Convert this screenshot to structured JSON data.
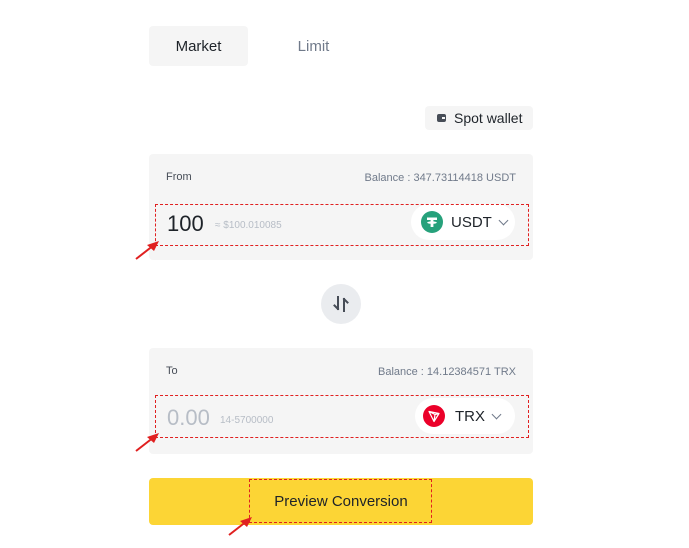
{
  "tabs": {
    "market": "Market",
    "limit": "Limit"
  },
  "spot_wallet": {
    "label": "Spot wallet",
    "icon": "wallet-icon"
  },
  "from": {
    "label": "From",
    "balance": "Balance : 347.73114418 USDT",
    "amount": "100",
    "approx_value": "≈ $100.010085",
    "coin": "USDT",
    "coin_icon_color": "#26a17b"
  },
  "swap": {
    "icon": "swap-arrows-icon"
  },
  "to": {
    "label": "To",
    "balance": "Balance : 14.12384571 TRX",
    "amount_placeholder": "0.00",
    "range": "14-5700000",
    "coin": "TRX",
    "coin_icon_color": "#eb0029"
  },
  "preview_button": "Preview Conversion",
  "colors": {
    "accent": "#fcd535",
    "annotation": "#e02020"
  }
}
